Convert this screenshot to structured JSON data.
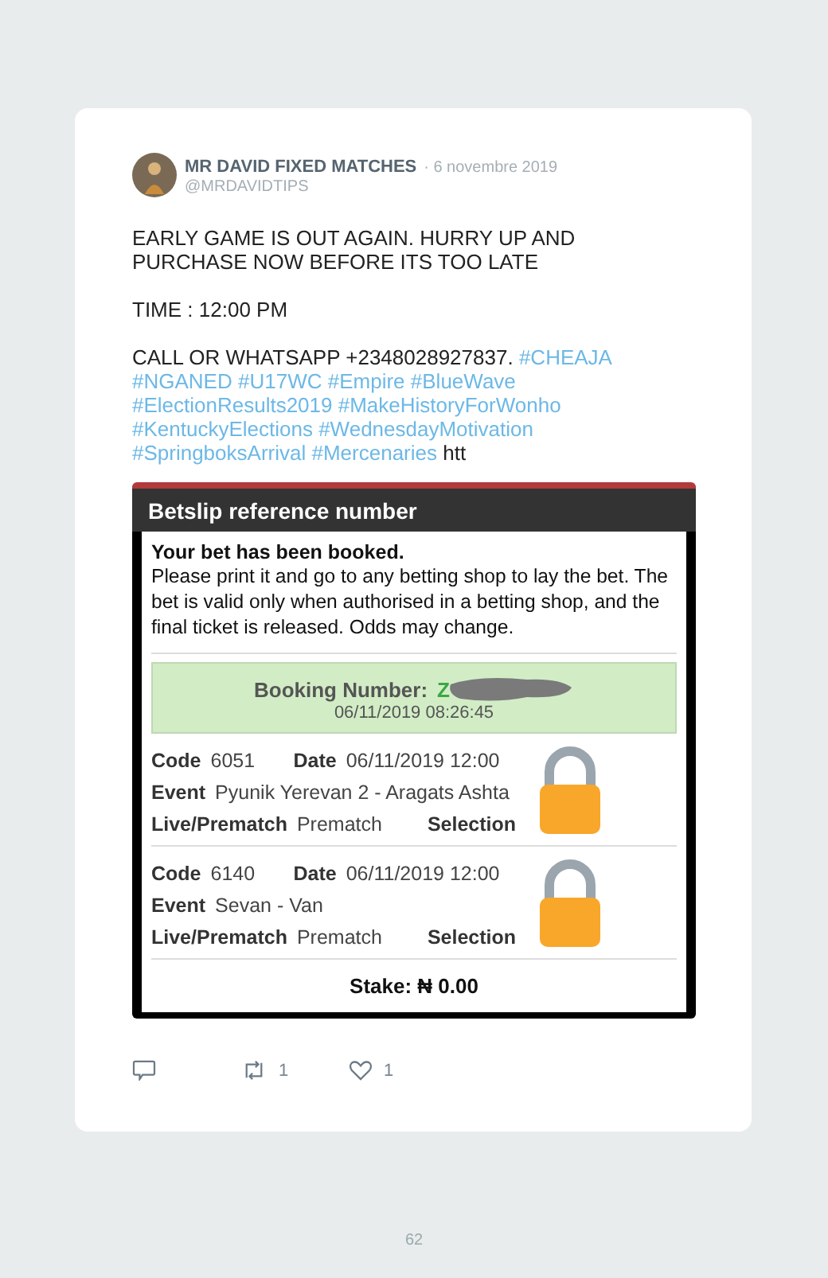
{
  "tweet": {
    "author": "MR DAVID FIXED MATCHES",
    "date": "· 6 novembre 2019",
    "handle": "@MRDAVIDTIPS",
    "paragraphs": [
      {
        "text": "EARLY GAME IS OUT AGAIN. HURRY UP AND PURCHASE NOW BEFORE ITS TOO LATE"
      },
      {
        "text": "TIME : 12:00 PM"
      },
      {
        "text": "CALL OR WHATSAPP +2348028927837.",
        "hashtags": [
          "#CHEAJA",
          "#NGANED",
          "#U17WC",
          "#Empire",
          "#BlueWave",
          "#ElectionResults2019",
          "#MakeHistoryForWonho",
          "#KentuckyElections",
          "#WednesdayMotivation",
          "#SpringboksArrival",
          "#Mercenaries"
        ],
        "tail": "htt"
      }
    ],
    "betslip": {
      "title": "Betslip reference number",
      "booked": "Your bet has been booked.",
      "instructions": "Please print it and go to any betting shop to lay the bet. The bet is valid only when authorised in a betting shop, and the final ticket is released. Odds may change.",
      "booking_label": "Booking Number:",
      "booking_value": "Z",
      "booking_time": "06/11/2019 08:26:45",
      "bets": [
        {
          "code_label": "Code",
          "code": "6051",
          "date_label": "Date",
          "date": "06/11/2019 12:00",
          "event_label": "Event",
          "event": "Pyunik Yerevan 2 - Aragats Ashta",
          "live_label": "Live/Prematch",
          "live": "Prematch",
          "selection_label": "Selection"
        },
        {
          "code_label": "Code",
          "code": "6140",
          "date_label": "Date",
          "date": "06/11/2019 12:00",
          "event_label": "Event",
          "event": "Sevan - Van",
          "live_label": "Live/Prematch",
          "live": "Prematch",
          "selection_label": "Selection"
        }
      ],
      "stake": "Stake: ₦ 0.00"
    },
    "actions": [
      {
        "kind": "reply"
      },
      {
        "kind": "retweet",
        "count": "1"
      },
      {
        "kind": "like",
        "count": "1"
      }
    ]
  },
  "page_number": "62"
}
